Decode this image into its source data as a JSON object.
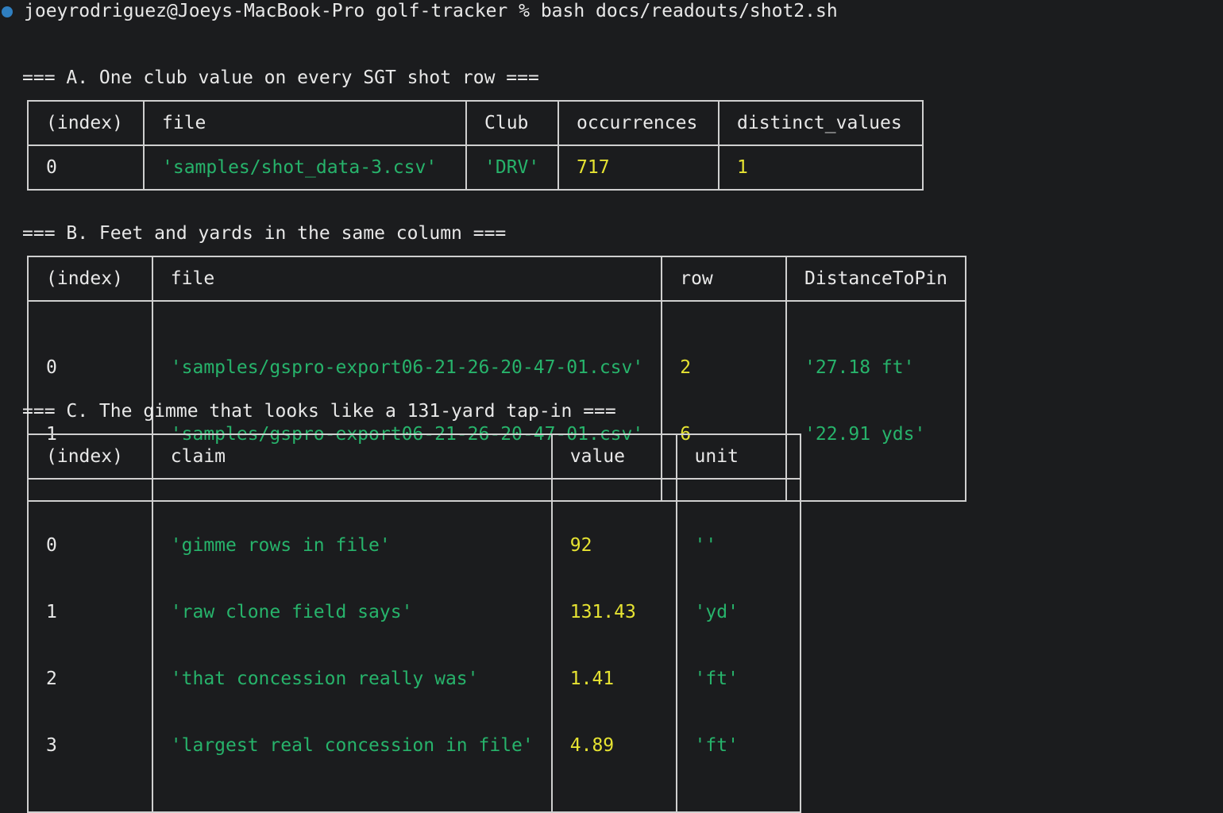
{
  "terminal": {
    "prompt": "joeyrodriguez@Joeys-MacBook-Pro golf-tracker % bash docs/readouts/shot2.sh"
  },
  "sections": {
    "a": {
      "title": "=== A. One club value on every SGT shot row ===",
      "headers": [
        "(index)",
        "file",
        "Club",
        "occurrences",
        "distinct_values"
      ],
      "rows": [
        {
          "index": "0",
          "file": "'samples/shot_data-3.csv'",
          "club": "'DRV'",
          "occurrences": "717",
          "distinct_values": "1"
        }
      ]
    },
    "b": {
      "title": "=== B. Feet and yards in the same column ===",
      "headers": [
        "(index)",
        "file",
        "row",
        "DistanceToPin"
      ],
      "rows": [
        {
          "index": "0",
          "file": "'samples/gspro-export06-21-26-20-47-01.csv'",
          "row": "2",
          "distance": "'27.18 ft'"
        },
        {
          "index": "1",
          "file": "'samples/gspro-export06-21-26-20-47-01.csv'",
          "row": "6",
          "distance": "'22.91 yds'"
        }
      ]
    },
    "c": {
      "title": "=== C. The gimme that looks like a 131-yard tap-in ===",
      "headers": [
        "(index)",
        "claim",
        "value",
        "unit"
      ],
      "rows": [
        {
          "index": "0",
          "claim": "'gimme rows in file'",
          "value": "92",
          "unit": "''"
        },
        {
          "index": "1",
          "claim": "'raw clone field says'",
          "value": "131.43",
          "unit": "'yd'"
        },
        {
          "index": "2",
          "claim": "'that concession really was'",
          "value": "1.41",
          "unit": "'ft'"
        },
        {
          "index": "3",
          "claim": "'largest real concession in file'",
          "value": "4.89",
          "unit": "'ft'"
        }
      ]
    }
  },
  "colors": {
    "background": "#1b1c1e",
    "string": "#27b36b",
    "number": "#e6e332",
    "border": "#cfcfcf",
    "prompt_dot": "#2f7fc1"
  }
}
